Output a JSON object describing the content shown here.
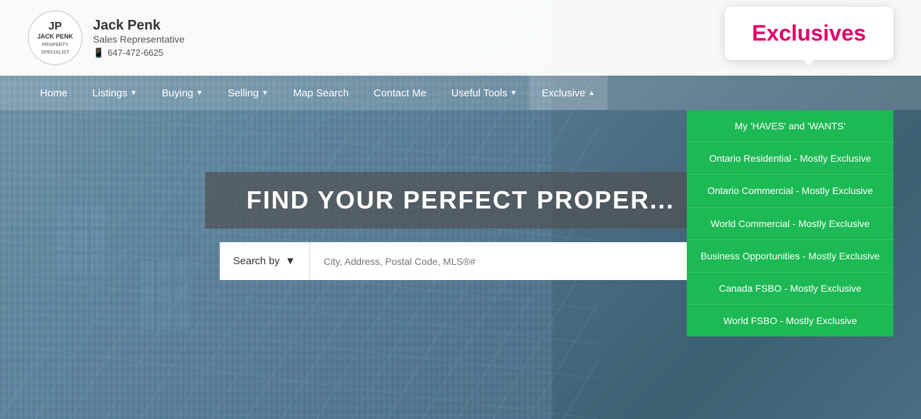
{
  "header": {
    "logo_initials": "JP",
    "logo_subtitle": "JACK PENK",
    "logo_tagline": "PROPERTY SPECIALIST",
    "agent_name": "Jack Penk",
    "agent_title": "Sales Representative",
    "agent_phone": "647-472-6625",
    "phone_icon": "📱"
  },
  "exclusives_bubble": {
    "title": "Exclusives"
  },
  "navbar": {
    "items": [
      {
        "label": "Home",
        "has_arrow": false
      },
      {
        "label": "Listings",
        "has_arrow": true
      },
      {
        "label": "Buying",
        "has_arrow": true
      },
      {
        "label": "Selling",
        "has_arrow": true
      },
      {
        "label": "Map Search",
        "has_arrow": false
      },
      {
        "label": "Contact Me",
        "has_arrow": false
      },
      {
        "label": "Useful Tools",
        "has_arrow": true
      },
      {
        "label": "Exclusive",
        "has_arrow": true,
        "is_active": true
      }
    ]
  },
  "dropdown": {
    "items": [
      {
        "label": "My 'HAVES' and 'WANTS'"
      },
      {
        "label": "Ontario Residential - Mostly Exclusive"
      },
      {
        "label": "Ontario Commercial - Mostly Exclusive"
      },
      {
        "label": "World Commercial - Mostly Exclusive"
      },
      {
        "label": "Business Opportunities - Mostly Exclusive"
      },
      {
        "label": "Canada FSBO - Mostly Exclusive"
      },
      {
        "label": "World FSBO - Mostly Exclusive"
      }
    ]
  },
  "hero": {
    "title": "FIND YOUR PERFECT PROPER...",
    "search_by_label": "Search by",
    "search_placeholder": "City, Address, Postal Code, MLS®#"
  }
}
